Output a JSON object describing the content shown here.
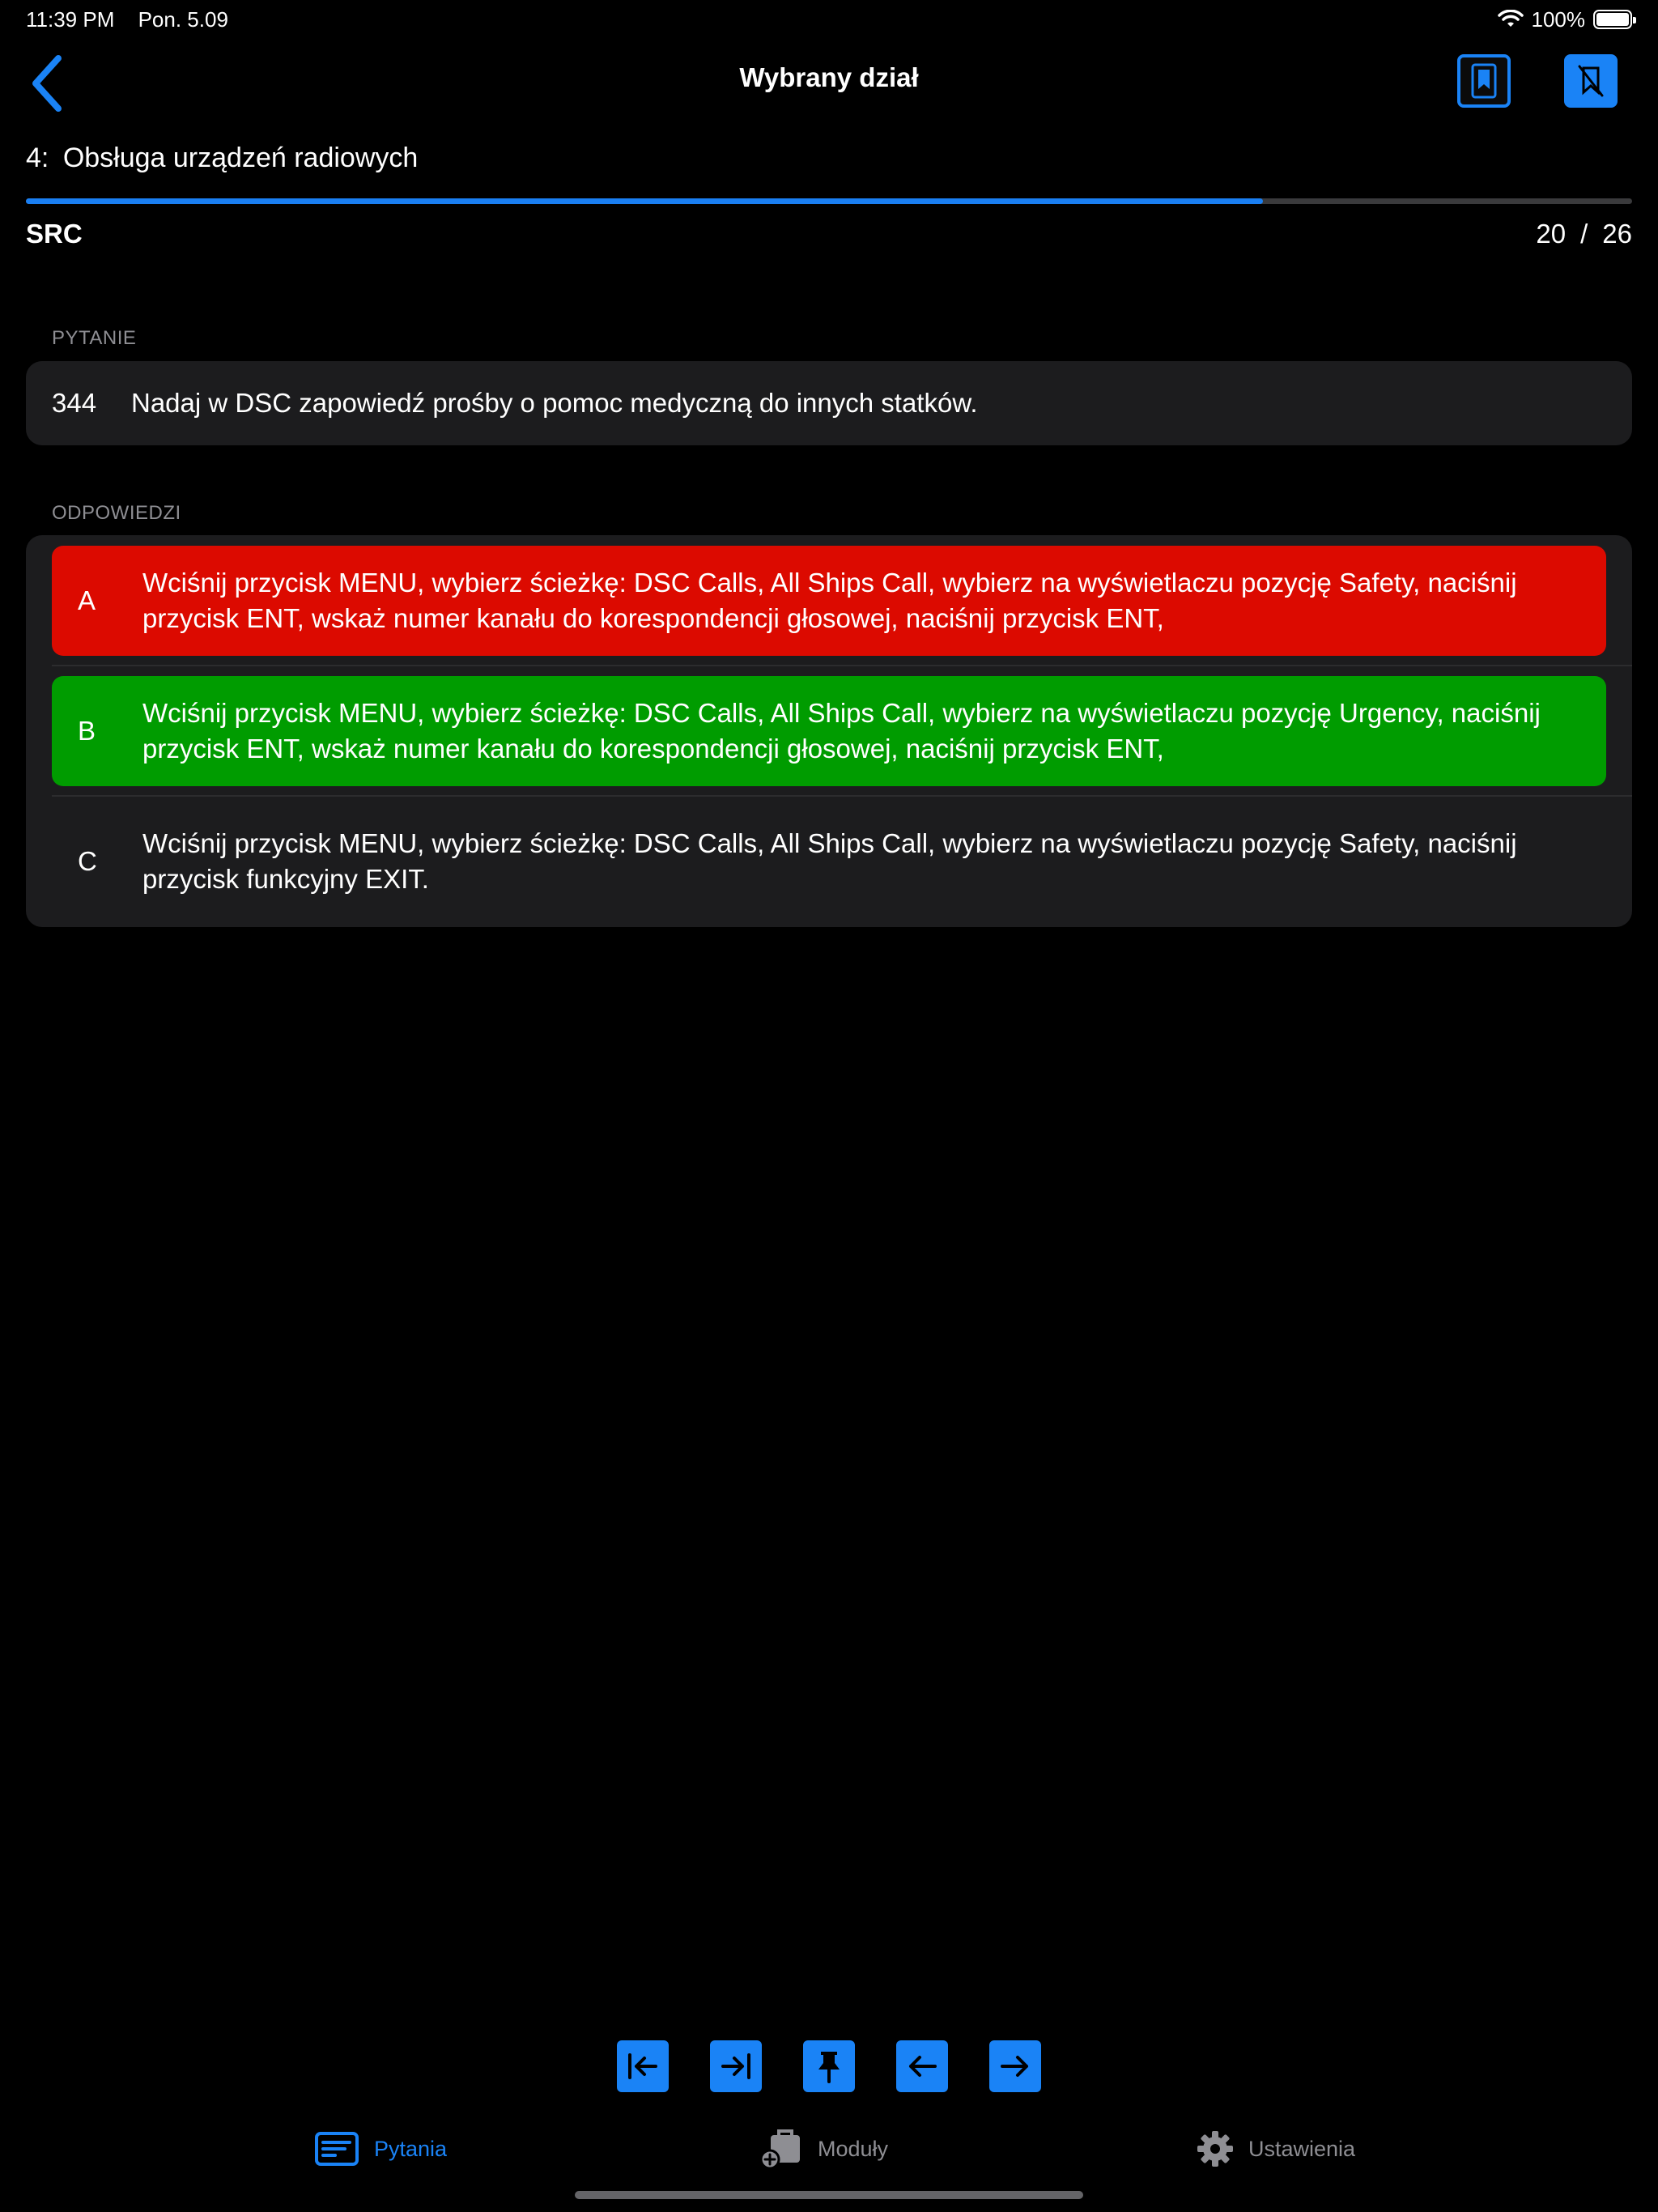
{
  "status_bar": {
    "time": "11:39 PM",
    "date": "Pon. 5.09",
    "battery": "100%"
  },
  "nav": {
    "title": "Wybrany dział"
  },
  "section": {
    "number": "4:",
    "title": "Obsługa urządzeń radiowych",
    "subject": "SRC",
    "current": "20",
    "separator": "/",
    "total": "26",
    "progress": 0.77
  },
  "question": {
    "label": "PYTANIE",
    "number": "344",
    "text": "Nadaj w DSC zapowiedź prośby o pomoc medyczną do innych statków."
  },
  "answers": {
    "label": "ODPOWIEDZI",
    "items": [
      {
        "letter": "A",
        "state": "wrong",
        "text": "Wciśnij przycisk MENU, wybierz ścieżkę: DSC Calls, All Ships Call, wybierz na wyświetlaczu pozycję Safety, naciśnij przycisk ENT, wskaż numer kanału do korespondencji głosowej, naciśnij przycisk ENT,"
      },
      {
        "letter": "B",
        "state": "right",
        "text": "Wciśnij przycisk MENU, wybierz ścieżkę: DSC Calls, All Ships Call, wybierz na wyświetlaczu pozycję Urgency, naciśnij przycisk ENT, wskaż numer kanału do korespondencji głosowej, naciśnij przycisk ENT,"
      },
      {
        "letter": "C",
        "state": "neutral",
        "text": "Wciśnij przycisk MENU, wybierz ścieżkę: DSC Calls, All Ships Call, wybierz na wyświetlaczu pozycję Safety, naciśnij przycisk funkcyjny EXIT."
      }
    ]
  },
  "toolbar": {
    "icons": [
      "first-question-icon",
      "last-question-icon",
      "pin-icon",
      "previous-arrow-icon",
      "next-arrow-icon"
    ]
  },
  "tabs": [
    {
      "label": "Pytania",
      "icon": "questions-icon",
      "active": true
    },
    {
      "label": "Moduły",
      "icon": "modules-icon",
      "active": false
    },
    {
      "label": "Ustawienia",
      "icon": "gear-icon",
      "active": false
    }
  ],
  "colors": {
    "accent": "#1a83f6",
    "wrong": "#dc0a00",
    "correct": "#009c00",
    "card": "#1c1c1e",
    "background": "#000000"
  }
}
